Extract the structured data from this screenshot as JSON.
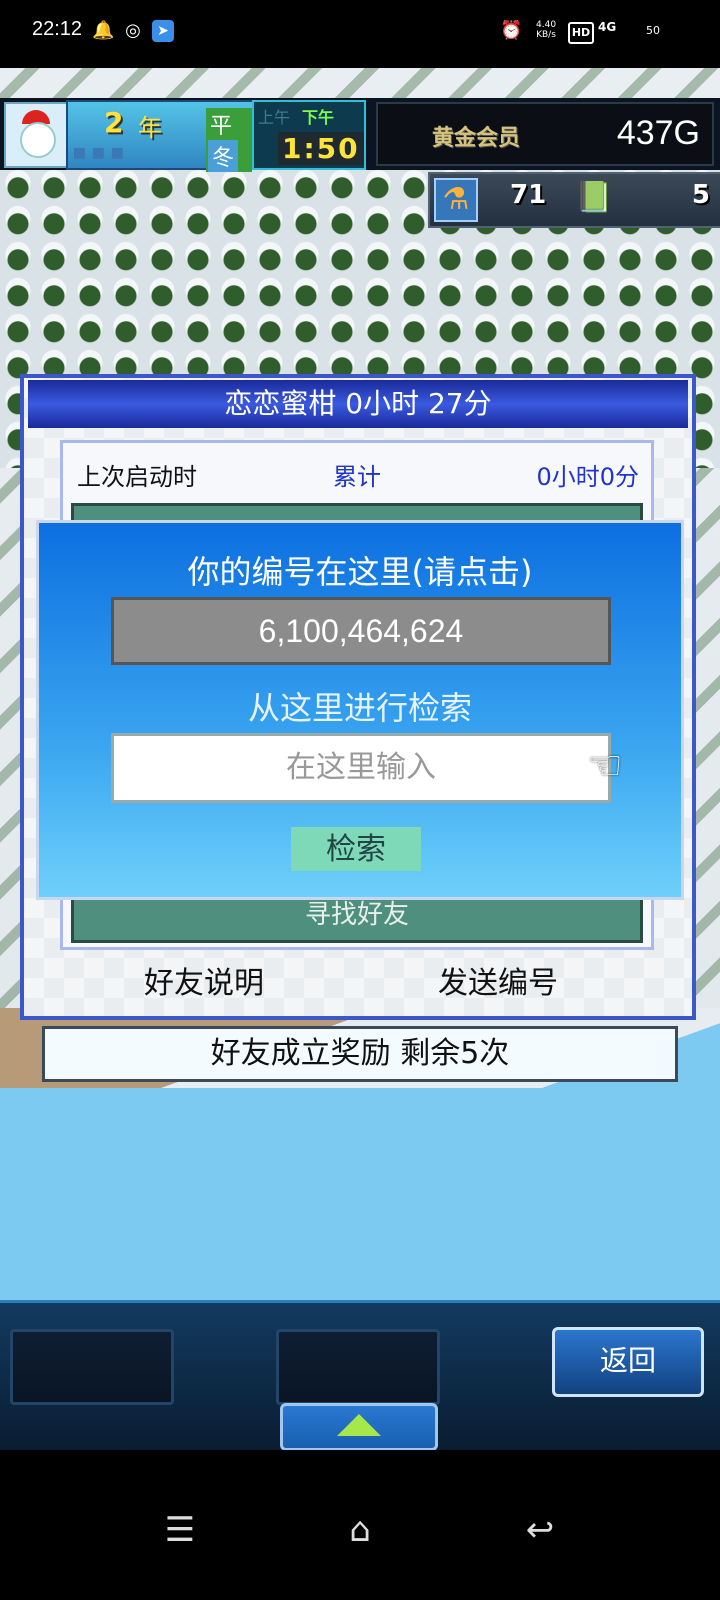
{
  "status_bar": {
    "time": "22:12",
    "net_speed": "4.40\nKB/s",
    "hd": "HD",
    "signal": "4G",
    "battery": "50"
  },
  "hud": {
    "year_num": "2",
    "year_label": "年",
    "weekday": "平日",
    "season": "冬",
    "am": "上午",
    "pm": "下午",
    "time": "1:50",
    "member_label": "黄金会员",
    "gold": "437G"
  },
  "resources": {
    "research_points": "71",
    "books": "5"
  },
  "friend_dialog": {
    "title": "恋恋蜜柑  0小时 27分",
    "last_launch_label": "上次启动时",
    "total_label": "累计",
    "total_value": "0小时0分",
    "find_friend": "寻找好友",
    "explain_button": "好友说明",
    "send_id_button": "发送编号"
  },
  "search_popup": {
    "header": "你的编号在这里(请点击)",
    "id_value": "6,100,464,624",
    "search_label": "从这里进行检索",
    "input_placeholder": "在这里输入",
    "search_button": "检索"
  },
  "reward_bar": {
    "text": "好友成立奖励  剩余5次"
  },
  "controls": {
    "back_button": "返回"
  },
  "nav": {
    "menu": "☰",
    "home": "⌂",
    "back": "↩"
  }
}
